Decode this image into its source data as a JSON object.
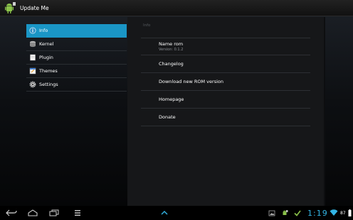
{
  "app": {
    "title": "Update Me"
  },
  "sidebar": {
    "items": [
      {
        "label": "Info",
        "icon": "info-icon",
        "selected": true
      },
      {
        "label": "Kernel",
        "icon": "kernel-icon",
        "selected": false
      },
      {
        "label": "Plugin",
        "icon": "plugin-icon",
        "selected": false
      },
      {
        "label": "Themes",
        "icon": "themes-icon",
        "selected": false
      },
      {
        "label": "Settings",
        "icon": "gear-icon",
        "selected": false
      }
    ]
  },
  "detail": {
    "section_header": "Info",
    "prefs": [
      {
        "title": "Name rom",
        "summary": "Version: 0.1.2"
      },
      {
        "title": "Changelog",
        "summary": ""
      },
      {
        "title": "Download new ROM version",
        "summary": ""
      },
      {
        "title": "Homepage",
        "summary": ""
      },
      {
        "title": "Donate",
        "summary": ""
      }
    ]
  },
  "statusbar": {
    "time": "1:19",
    "battery": "87"
  },
  "colors": {
    "accent": "#1a96c6",
    "clock": "#33b5e5"
  }
}
